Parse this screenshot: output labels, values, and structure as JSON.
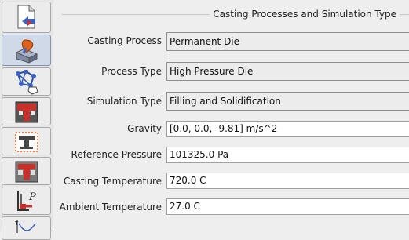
{
  "panel": {
    "title": "Casting Processes and Simulation Type"
  },
  "form": {
    "rows": [
      {
        "label": "Casting Process",
        "value": "Permanent Die"
      },
      {
        "label": "Process Type",
        "value": "High Pressure Die"
      },
      {
        "label": "Simulation Type",
        "value": "Filling and Solidification"
      },
      {
        "label": "Gravity",
        "value": "[0.0, 0.0, -9.81] m/s^2"
      },
      {
        "label": "Reference Pressure",
        "value": "101325.0 Pa"
      },
      {
        "label": "Casting Temperature",
        "value": "720.0 C"
      },
      {
        "label": "Ambient Temperature",
        "value": "27.0 C"
      }
    ]
  },
  "sidebar": {
    "tabs": [
      {
        "icon": "document-arrow-icon"
      },
      {
        "icon": "casting-process-icon",
        "active": true
      },
      {
        "icon": "mesh-network-icon"
      },
      {
        "icon": "die-cross-section-icon"
      },
      {
        "icon": "die-insert-icon"
      },
      {
        "icon": "die-cavity-icon"
      },
      {
        "icon": "pressure-gauge-icon"
      },
      {
        "icon": "temperature-curve-icon"
      }
    ]
  },
  "colors": {
    "accent_blue": "#3a62c4",
    "accent_orange": "#e0621b",
    "accent_red": "#c8302a",
    "active_tab": "#cfd9e8"
  }
}
